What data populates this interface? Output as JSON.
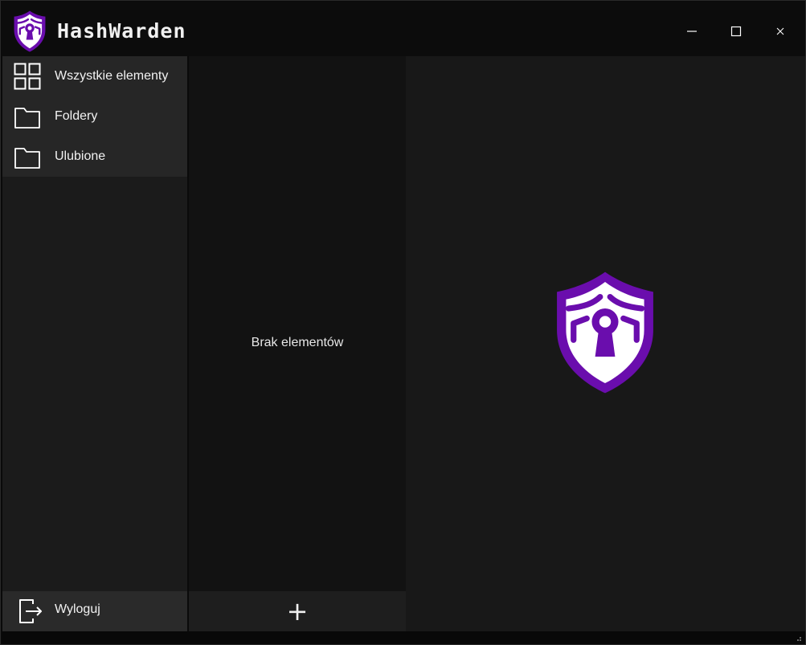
{
  "app": {
    "title": "HashWarden",
    "logo_icon": "shield-keyhole-icon",
    "brand_color": "#6a0dad"
  },
  "window_controls": {
    "minimize_icon": "minimize-icon",
    "maximize_icon": "maximize-icon",
    "close_icon": "close-icon"
  },
  "sidebar": {
    "items": [
      {
        "label": "Wszystkie elementy",
        "icon": "grid-icon"
      },
      {
        "label": "Foldery",
        "icon": "folder-icon"
      },
      {
        "label": "Ulubione",
        "icon": "folder-icon"
      }
    ],
    "logout": {
      "label": "Wyloguj",
      "icon": "logout-icon"
    }
  },
  "list": {
    "empty_text": "Brak elementów",
    "add_label": "+"
  }
}
